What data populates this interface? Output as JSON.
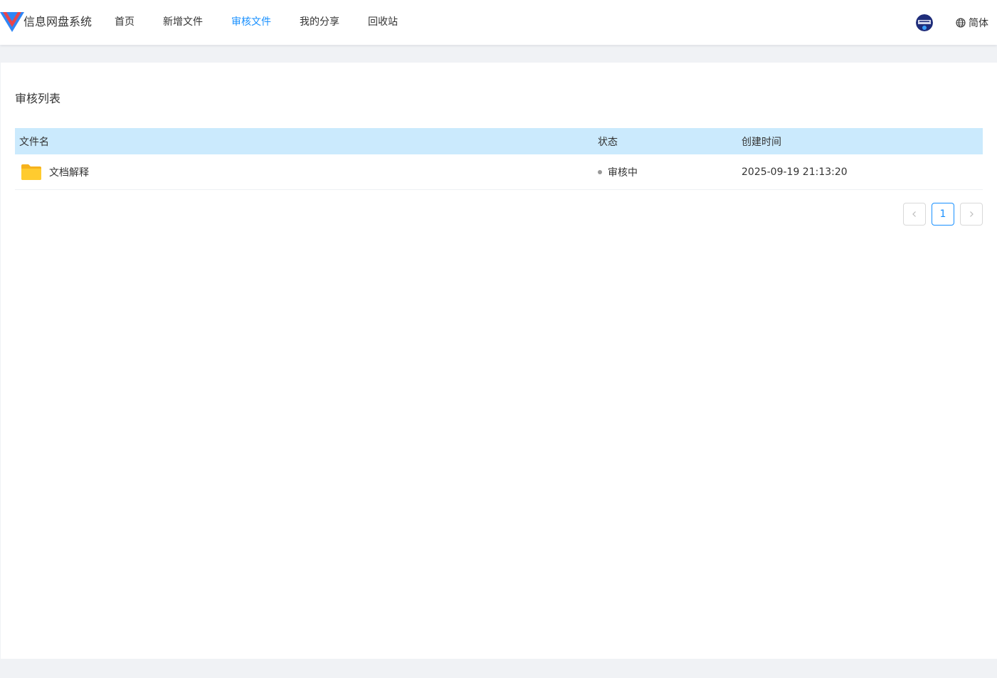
{
  "app": {
    "title": "信息网盘系统"
  },
  "nav": {
    "items": [
      {
        "label": "首页",
        "active": false
      },
      {
        "label": "新增文件",
        "active": false
      },
      {
        "label": "审核文件",
        "active": true
      },
      {
        "label": "我的分享",
        "active": false
      },
      {
        "label": "回收站",
        "active": false
      }
    ]
  },
  "header": {
    "language": "简体",
    "language_icon": "globe-icon",
    "accent_color": "#1890ff"
  },
  "review": {
    "title": "审核列表",
    "columns": {
      "name": "文件名",
      "status": "状态",
      "created": "创建时间"
    },
    "rows": [
      {
        "name": "文档解释",
        "icon": "folder-icon",
        "status": "审核中",
        "created": "2025-09-19 21:13:20"
      }
    ],
    "header_bg": "#cbeafd"
  },
  "pagination": {
    "current": "1",
    "prev_icon": "chevron-left-icon",
    "next_icon": "chevron-right-icon"
  }
}
